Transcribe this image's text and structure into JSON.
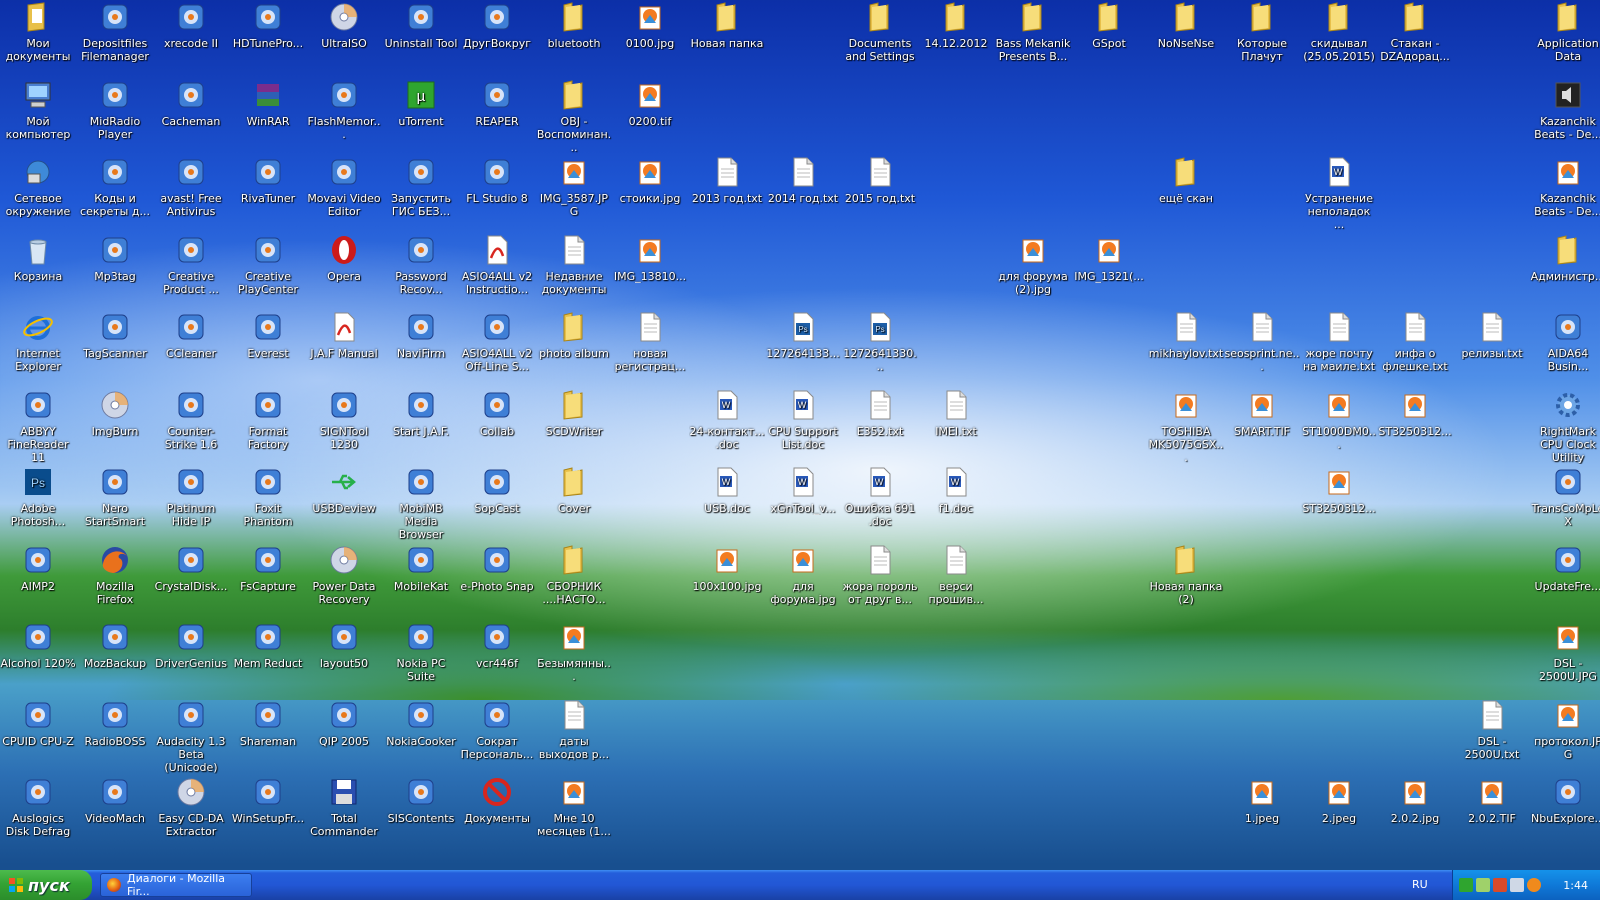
{
  "desktop": {
    "icons": [
      {
        "label": "Мои документы",
        "icon": "my-documents-icon",
        "col": 0,
        "row": 0
      },
      {
        "label": "Depositfiles Filemanager",
        "icon": "app-icon",
        "col": 1,
        "row": 0
      },
      {
        "label": "xrecode II",
        "icon": "app-icon",
        "col": 2,
        "row": 0
      },
      {
        "label": "HDTunePro...",
        "icon": "app-icon",
        "col": 3,
        "row": 0
      },
      {
        "label": "UltraISO",
        "icon": "disc-icon",
        "col": 4,
        "row": 0
      },
      {
        "label": "Uninstall Tool",
        "icon": "app-icon",
        "col": 5,
        "row": 0
      },
      {
        "label": "ДругВокруг",
        "icon": "app-icon",
        "col": 6,
        "row": 0
      },
      {
        "label": "bluetooth",
        "icon": "folder-icon",
        "col": 7,
        "row": 0
      },
      {
        "label": "0100.jpg",
        "icon": "image-file-icon",
        "col": 8,
        "row": 0
      },
      {
        "label": "Новая папка",
        "icon": "folder-icon",
        "col": 9,
        "row": 0
      },
      {
        "label": "Documents and Settings",
        "icon": "folder-icon",
        "col": 11,
        "row": 0
      },
      {
        "label": "14.12.2012",
        "icon": "folder-icon",
        "col": 12,
        "row": 0
      },
      {
        "label": "Bass Mekanik Presents B...",
        "icon": "folder-icon",
        "col": 13,
        "row": 0
      },
      {
        "label": "GSpot",
        "icon": "folder-icon",
        "col": 14,
        "row": 0
      },
      {
        "label": "NoNseNse",
        "icon": "folder-icon",
        "col": 15,
        "row": 0
      },
      {
        "label": "Которые Плачут",
        "icon": "folder-icon",
        "col": 16,
        "row": 0
      },
      {
        "label": "скидывал (25.05.2015)",
        "icon": "folder-icon",
        "col": 17,
        "row": 0
      },
      {
        "label": "Стакан - DZAдорац...",
        "icon": "folder-icon",
        "col": 18,
        "row": 0
      },
      {
        "label": "Application Data",
        "icon": "folder-icon",
        "col": 20,
        "row": 0
      },
      {
        "label": "Мой компьютер",
        "icon": "my-computer-icon",
        "col": 0,
        "row": 1
      },
      {
        "label": "MidRadio Player",
        "icon": "app-icon",
        "col": 1,
        "row": 1
      },
      {
        "label": "Cacheman",
        "icon": "app-icon",
        "col": 2,
        "row": 1
      },
      {
        "label": "WinRAR",
        "icon": "archive-icon",
        "col": 3,
        "row": 1
      },
      {
        "label": "FlashMemor...",
        "icon": "app-icon",
        "col": 4,
        "row": 1
      },
      {
        "label": "uTorrent",
        "icon": "utorrent-icon",
        "col": 5,
        "row": 1
      },
      {
        "label": "REAPER",
        "icon": "app-icon",
        "col": 6,
        "row": 1
      },
      {
        "label": "OBJ - Воспоминан...",
        "icon": "folder-icon",
        "col": 7,
        "row": 1
      },
      {
        "label": "0200.tif",
        "icon": "image-file-icon",
        "col": 8,
        "row": 1
      },
      {
        "label": "Kazanchik Beats - De...",
        "icon": "audio-file-icon",
        "col": 20,
        "row": 1
      },
      {
        "label": "Сетевое окружение",
        "icon": "network-icon",
        "col": 0,
        "row": 2
      },
      {
        "label": "Коды и секреты д...",
        "icon": "app-icon",
        "col": 1,
        "row": 2
      },
      {
        "label": "avast! Free Antivirus",
        "icon": "app-icon",
        "col": 2,
        "row": 2
      },
      {
        "label": "RivaTuner",
        "icon": "app-icon",
        "col": 3,
        "row": 2
      },
      {
        "label": "Movavi Video Editor",
        "icon": "app-icon",
        "col": 4,
        "row": 2
      },
      {
        "label": "Запустить ГИС БЕЗ...",
        "icon": "app-icon",
        "col": 5,
        "row": 2
      },
      {
        "label": "FL Studio 8",
        "icon": "app-icon",
        "col": 6,
        "row": 2
      },
      {
        "label": "IMG_3587.JPG",
        "icon": "image-file-icon",
        "col": 7,
        "row": 2
      },
      {
        "label": "стоики.jpg",
        "icon": "image-file-icon",
        "col": 8,
        "row": 2
      },
      {
        "label": "2013 год.txt",
        "icon": "text-file-icon",
        "col": 9,
        "row": 2
      },
      {
        "label": "2014 год.txt",
        "icon": "text-file-icon",
        "col": 10,
        "row": 2
      },
      {
        "label": "2015 год.txt",
        "icon": "text-file-icon",
        "col": 11,
        "row": 2
      },
      {
        "label": "ещё скан",
        "icon": "folder-icon",
        "col": 15,
        "row": 2
      },
      {
        "label": "Устранение неполадок ...",
        "icon": "word-doc-icon",
        "col": 17,
        "row": 2
      },
      {
        "label": "Kazanchik Beats - De...",
        "icon": "image-file-icon",
        "col": 20,
        "row": 2
      },
      {
        "label": "Корзина",
        "icon": "recycle-bin-icon",
        "col": 0,
        "row": 3
      },
      {
        "label": "Mp3tag",
        "icon": "app-icon",
        "col": 1,
        "row": 3
      },
      {
        "label": "Creative Product ...",
        "icon": "app-icon",
        "col": 2,
        "row": 3
      },
      {
        "label": "Creative PlayCenter",
        "icon": "app-icon",
        "col": 3,
        "row": 3
      },
      {
        "label": "Opera",
        "icon": "opera-icon",
        "col": 4,
        "row": 3
      },
      {
        "label": "Password Recov...",
        "icon": "app-icon",
        "col": 5,
        "row": 3
      },
      {
        "label": "ASIO4ALL v2 Instructio...",
        "icon": "pdf-icon",
        "col": 6,
        "row": 3
      },
      {
        "label": "Недавние документы",
        "icon": "text-file-icon",
        "col": 7,
        "row": 3
      },
      {
        "label": "IMG_13810...",
        "icon": "image-file-icon",
        "col": 8,
        "row": 3
      },
      {
        "label": "для форума (2).jpg",
        "icon": "image-file-icon",
        "col": 13,
        "row": 3
      },
      {
        "label": "IMG_1321(...",
        "icon": "image-file-icon",
        "col": 14,
        "row": 3
      },
      {
        "label": "Администр...",
        "icon": "folder-icon",
        "col": 20,
        "row": 3
      },
      {
        "label": "Internet Explorer",
        "icon": "ie-icon",
        "col": 0,
        "row": 4
      },
      {
        "label": "TagScanner",
        "icon": "app-icon",
        "col": 1,
        "row": 4
      },
      {
        "label": "CCleaner",
        "icon": "app-icon",
        "col": 2,
        "row": 4
      },
      {
        "label": "Everest",
        "icon": "app-icon",
        "col": 3,
        "row": 4
      },
      {
        "label": "J.A.F Manual",
        "icon": "pdf-icon",
        "col": 4,
        "row": 4
      },
      {
        "label": "NaviFirm",
        "icon": "app-icon",
        "col": 5,
        "row": 4
      },
      {
        "label": "ASIO4ALL v2 Off-Line S...",
        "icon": "app-icon",
        "col": 6,
        "row": 4
      },
      {
        "label": "photo album",
        "icon": "folder-icon",
        "col": 7,
        "row": 4
      },
      {
        "label": "новая регистрац...",
        "icon": "text-file-icon",
        "col": 8,
        "row": 4
      },
      {
        "label": "127264133...",
        "icon": "psd-file-icon",
        "col": 10,
        "row": 4
      },
      {
        "label": "1272641330...",
        "icon": "psd-file-icon",
        "col": 11,
        "row": 4
      },
      {
        "label": "mikhaylov.txt",
        "icon": "text-file-icon",
        "col": 15,
        "row": 4
      },
      {
        "label": "seosprint.ne...",
        "icon": "text-file-icon",
        "col": 16,
        "row": 4
      },
      {
        "label": "жоре почту на маиле.txt",
        "icon": "text-file-icon",
        "col": 17,
        "row": 4
      },
      {
        "label": "инфа о флешке.txt",
        "icon": "text-file-icon",
        "col": 18,
        "row": 4
      },
      {
        "label": "релизы.txt",
        "icon": "text-file-icon",
        "col": 19,
        "row": 4
      },
      {
        "label": "AIDA64 Busin...",
        "icon": "app-icon",
        "col": 20,
        "row": 4
      },
      {
        "label": "ABBYY FineReader 11",
        "icon": "app-icon",
        "col": 0,
        "row": 5
      },
      {
        "label": "ImgBurn",
        "icon": "disc-icon",
        "col": 1,
        "row": 5
      },
      {
        "label": "Counter-Strike 1.6",
        "icon": "app-icon",
        "col": 2,
        "row": 5
      },
      {
        "label": "Format Factory",
        "icon": "app-icon",
        "col": 3,
        "row": 5
      },
      {
        "label": "SIGNTool 1230",
        "icon": "app-icon",
        "col": 4,
        "row": 5
      },
      {
        "label": "Start J.A.F.",
        "icon": "app-icon",
        "col": 5,
        "row": 5
      },
      {
        "label": "Collab",
        "icon": "app-icon",
        "col": 6,
        "row": 5
      },
      {
        "label": "SCDWriter",
        "icon": "folder-icon",
        "col": 7,
        "row": 5
      },
      {
        "label": "24-контакт... .doc",
        "icon": "word-doc-icon",
        "col": 9,
        "row": 5
      },
      {
        "label": "CPU Support List.doc",
        "icon": "word-doc-icon",
        "col": 10,
        "row": 5
      },
      {
        "label": "E352.txt",
        "icon": "text-file-icon",
        "col": 11,
        "row": 5
      },
      {
        "label": "IMEI.txt",
        "icon": "text-file-icon",
        "col": 12,
        "row": 5
      },
      {
        "label": "TOSHIBA MK5075GSX...",
        "icon": "image-file-icon",
        "col": 15,
        "row": 5
      },
      {
        "label": "SMART.TIF",
        "icon": "image-file-icon",
        "col": 16,
        "row": 5
      },
      {
        "label": "ST1000DM0...",
        "icon": "image-file-icon",
        "col": 17,
        "row": 5
      },
      {
        "label": "ST3250312...",
        "icon": "image-file-icon",
        "col": 18,
        "row": 5
      },
      {
        "label": "RightMark CPU Clock Utility",
        "icon": "gear-icon",
        "col": 20,
        "row": 5
      },
      {
        "label": "Adobe Photosh...",
        "icon": "photoshop-icon",
        "col": 0,
        "row": 6
      },
      {
        "label": "Nero StartSmart",
        "icon": "app-icon",
        "col": 1,
        "row": 6
      },
      {
        "label": "Platinum Hide IP",
        "icon": "app-icon",
        "col": 2,
        "row": 6
      },
      {
        "label": "Foxit Phantom",
        "icon": "app-icon",
        "col": 3,
        "row": 6
      },
      {
        "label": "USBDeview",
        "icon": "usb-icon",
        "col": 4,
        "row": 6
      },
      {
        "label": "MobiMB Media Browser",
        "icon": "app-icon",
        "col": 5,
        "row": 6
      },
      {
        "label": "SopCast",
        "icon": "app-icon",
        "col": 6,
        "row": 6
      },
      {
        "label": "Cover",
        "icon": "folder-icon",
        "col": 7,
        "row": 6
      },
      {
        "label": "USB.doc",
        "icon": "word-doc-icon",
        "col": 9,
        "row": 6
      },
      {
        "label": "xGnTool_v...",
        "icon": "word-doc-icon",
        "col": 10,
        "row": 6
      },
      {
        "label": "Ошибка 691 .doc",
        "icon": "word-doc-icon",
        "col": 11,
        "row": 6
      },
      {
        "label": "f1.doc",
        "icon": "word-doc-icon",
        "col": 12,
        "row": 6
      },
      {
        "label": "ST3250312...",
        "icon": "image-file-icon",
        "col": 17,
        "row": 6
      },
      {
        "label": "TransCoMpLeX",
        "icon": "app-icon",
        "col": 20,
        "row": 6
      },
      {
        "label": "AIMP2",
        "icon": "app-icon",
        "col": 0,
        "row": 7
      },
      {
        "label": "Mozilla Firefox",
        "icon": "firefox-icon",
        "col": 1,
        "row": 7
      },
      {
        "label": "CrystalDisk...",
        "icon": "app-icon",
        "col": 2,
        "row": 7
      },
      {
        "label": "FsCapture",
        "icon": "app-icon",
        "col": 3,
        "row": 7
      },
      {
        "label": "Power Data Recovery",
        "icon": "disc-icon",
        "col": 4,
        "row": 7
      },
      {
        "label": "MobileKat",
        "icon": "app-icon",
        "col": 5,
        "row": 7
      },
      {
        "label": "e-Photo Snap",
        "icon": "app-icon",
        "col": 6,
        "row": 7
      },
      {
        "label": "СБОРНИК ....НАСТО...",
        "icon": "folder-icon",
        "col": 7,
        "row": 7
      },
      {
        "label": "100x100.jpg",
        "icon": "image-file-icon",
        "col": 9,
        "row": 7
      },
      {
        "label": "для форума.jpg",
        "icon": "image-file-icon",
        "col": 10,
        "row": 7
      },
      {
        "label": "жора пороль от друг в...",
        "icon": "text-file-icon",
        "col": 11,
        "row": 7
      },
      {
        "label": "верси прошив...",
        "icon": "text-file-icon",
        "col": 12,
        "row": 7
      },
      {
        "label": "Новая папка (2)",
        "icon": "folder-icon",
        "col": 15,
        "row": 7
      },
      {
        "label": "UpdateFre...",
        "icon": "app-icon",
        "col": 20,
        "row": 7
      },
      {
        "label": "Alcohol 120%",
        "icon": "app-icon",
        "col": 0,
        "row": 8
      },
      {
        "label": "MozBackup",
        "icon": "app-icon",
        "col": 1,
        "row": 8
      },
      {
        "label": "DriverGenius",
        "icon": "app-icon",
        "col": 2,
        "row": 8
      },
      {
        "label": "Mem Reduct",
        "icon": "app-icon",
        "col": 3,
        "row": 8
      },
      {
        "label": "layout50",
        "icon": "app-icon",
        "col": 4,
        "row": 8
      },
      {
        "label": "Nokia PC Suite",
        "icon": "app-icon",
        "col": 5,
        "row": 8
      },
      {
        "label": "vcr446f",
        "icon": "app-icon",
        "col": 6,
        "row": 8
      },
      {
        "label": "Безымянны...",
        "icon": "image-file-icon",
        "col": 7,
        "row": 8
      },
      {
        "label": "DSL - 2500U.JPG",
        "icon": "image-file-icon",
        "col": 20,
        "row": 8
      },
      {
        "label": "CPUID CPU-Z",
        "icon": "app-icon",
        "col": 0,
        "row": 9
      },
      {
        "label": "RadioBOSS",
        "icon": "app-icon",
        "col": 1,
        "row": 9
      },
      {
        "label": "Audacity 1.3 Beta (Unicode)",
        "icon": "app-icon",
        "col": 2,
        "row": 9
      },
      {
        "label": "Shareman",
        "icon": "app-icon",
        "col": 3,
        "row": 9
      },
      {
        "label": "QIP 2005",
        "icon": "app-icon",
        "col": 4,
        "row": 9
      },
      {
        "label": "NokiaCooker",
        "icon": "app-icon",
        "col": 5,
        "row": 9
      },
      {
        "label": "Сократ Персональ...",
        "icon": "app-icon",
        "col": 6,
        "row": 9
      },
      {
        "label": "даты выходов р...",
        "icon": "text-file-icon",
        "col": 7,
        "row": 9
      },
      {
        "label": "DSL - 2500U.txt",
        "icon": "text-file-icon",
        "col": 19,
        "row": 9
      },
      {
        "label": "протокол.JPG",
        "icon": "image-file-icon",
        "col": 20,
        "row": 9
      },
      {
        "label": "Auslogics Disk Defrag",
        "icon": "app-icon",
        "col": 0,
        "row": 10
      },
      {
        "label": "VideoMach",
        "icon": "app-icon",
        "col": 1,
        "row": 10
      },
      {
        "label": "Easy CD-DA Extractor",
        "icon": "disc-icon",
        "col": 2,
        "row": 10
      },
      {
        "label": "WinSetupFr...",
        "icon": "app-icon",
        "col": 3,
        "row": 10
      },
      {
        "label": "Total Commander",
        "icon": "floppy-icon",
        "col": 4,
        "row": 10
      },
      {
        "label": "SISContents",
        "icon": "app-icon",
        "col": 5,
        "row": 10
      },
      {
        "label": "Документы",
        "icon": "forbidden-icon",
        "col": 6,
        "row": 10
      },
      {
        "label": "Мне 10 месяцев (1...",
        "icon": "image-file-icon",
        "col": 7,
        "row": 10
      },
      {
        "label": "1.jpeg",
        "icon": "image-file-icon",
        "col": 16,
        "row": 10
      },
      {
        "label": "2.jpeg",
        "icon": "image-file-icon",
        "col": 17,
        "row": 10
      },
      {
        "label": "2.0.2.jpg",
        "icon": "image-file-icon",
        "col": 18,
        "row": 10
      },
      {
        "label": "2.0.2.TIF",
        "icon": "image-file-icon",
        "col": 19,
        "row": 10
      },
      {
        "label": "NbuExplore...",
        "icon": "app-icon",
        "col": 20,
        "row": 10
      }
    ]
  },
  "taskbar": {
    "start_label": "пуск",
    "task_items": [
      {
        "label": "Диалоги - Mozilla Fir...",
        "icon": "firefox-icon"
      }
    ],
    "language": "RU",
    "clock": "1:44"
  },
  "colors": {
    "folder": "#f2d265",
    "taskbar": "#245edb",
    "start": "#34a334"
  }
}
